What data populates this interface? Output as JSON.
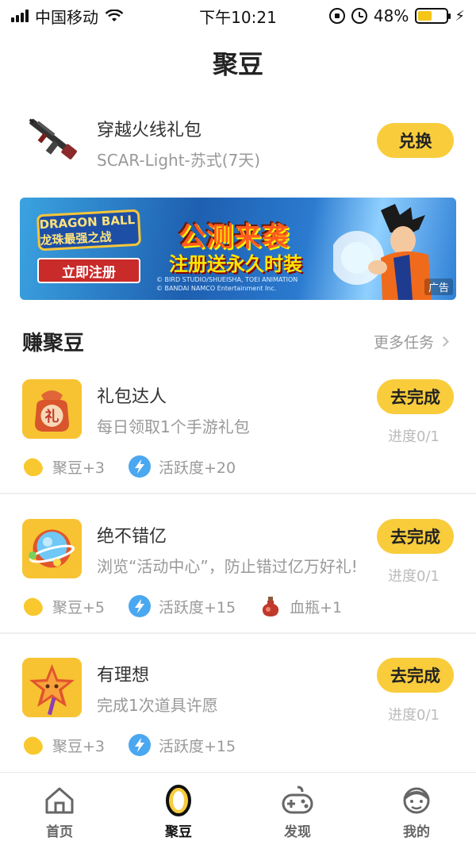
{
  "status_bar": {
    "carrier": "中国移动",
    "time": "下午10:21",
    "battery_percent": "48%",
    "battery_level": 0.48
  },
  "nav": {
    "title": "聚豆"
  },
  "gift": {
    "title": "穿越火线礼包",
    "subtitle": "SCAR-Light-苏式(7天)",
    "button": "兑换"
  },
  "banner": {
    "logo_text": "DRAGON BALL 龙珠最强之战",
    "register_label": "立即注册",
    "headline": "公测来袭",
    "subheadline": "注册送永久时装",
    "copyright_line1": "© BIRD STUDIO/SHUEISHA, TOEI ANIMATION",
    "copyright_line2": "© BANDAI NAMCO Entertainment Inc.",
    "ad_label": "广告"
  },
  "section": {
    "title": "赚聚豆",
    "more": "更多任务"
  },
  "tasks": [
    {
      "title": "礼包达人",
      "desc": "每日领取1个手游礼包",
      "button": "去完成",
      "progress": "进度0/1",
      "rewards": [
        "聚豆+3",
        "活跃度+20"
      ]
    },
    {
      "title": "绝不错亿",
      "desc": "浏览“活动中心”，防止错过亿万好礼!",
      "button": "去完成",
      "progress": "进度0/1",
      "rewards": [
        "聚豆+5",
        "活跃度+15",
        "血瓶+1"
      ]
    },
    {
      "title": "有理想",
      "desc": "完成1次道具许愿",
      "button": "去完成",
      "progress": "进度0/1",
      "rewards": [
        "聚豆+3",
        "活跃度+15"
      ]
    }
  ],
  "tabbar": {
    "items": [
      {
        "label": "首页"
      },
      {
        "label": "聚豆"
      },
      {
        "label": "发现"
      },
      {
        "label": "我的"
      }
    ],
    "active_index": 1
  },
  "colors": {
    "accent": "#f8cc3b",
    "icon_bg": "#f8c333",
    "muted_text": "#999999"
  }
}
